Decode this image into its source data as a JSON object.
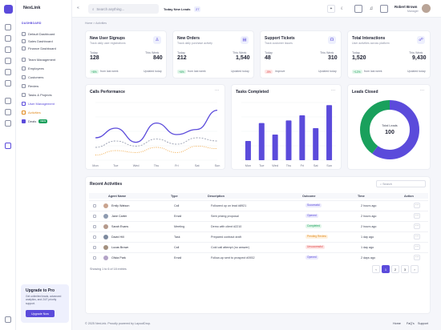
{
  "brand": "NexLink",
  "sidebar": {
    "section": "DASHBOARD",
    "items": [
      "Default Dashboard",
      "Sales Dashboard",
      "Finance Dashboard",
      "Team Management",
      "Employees",
      "Customers",
      "Review",
      "Tasks & Projects",
      "User Management",
      "Activities",
      "Deals"
    ],
    "new_badge": "NEW",
    "promo_title": "Upgrade to Pro",
    "promo_desc": "Get unlimited leads, advanced analytics, and 24/7 priority support.",
    "promo_button": "Upgrade Now"
  },
  "topbar": {
    "search_placeholder": "Search anything...",
    "today_label": "Today New Leads",
    "today_value": "27",
    "user_name": "Robert Brown",
    "user_role": "Manager"
  },
  "breadcrumb": "Home  >  Activities",
  "stats": [
    {
      "title": "New User Signups",
      "sub": "Track daily user registrations",
      "today_label": "Today",
      "today": "128",
      "week_label": "This Week",
      "week": "840",
      "change": "+8%",
      "change_text": "from last week",
      "updated": "Updated today"
    },
    {
      "title": "New Orders",
      "sub": "Track daily purchase activity",
      "today_label": "Today",
      "today": "212",
      "week_label": "This Week",
      "week": "1,540",
      "change": "+6%",
      "change_text": "from last week",
      "updated": "Updated today"
    },
    {
      "title": "Support Tickets",
      "sub": "Track customer issues",
      "today_label": "Today",
      "today": "48",
      "week_label": "This Week",
      "week": "310",
      "change": "-5%",
      "change_text": "improve",
      "updated": "Updated today"
    },
    {
      "title": "Total Interactions",
      "sub": "User activities across platform",
      "today_label": "Today",
      "today": "1,520",
      "week_label": "This Week",
      "week": "9,430",
      "change": "+12%",
      "change_text": "from last week",
      "updated": "Updated today"
    }
  ],
  "calls": {
    "title": "Calls Performance",
    "days": [
      "Mon",
      "Tue",
      "Wed",
      "Thu",
      "Fri",
      "Sat",
      "Sun"
    ]
  },
  "tasks": {
    "title": "Tasks Completed",
    "days": [
      "Mon",
      "Tue",
      "Wed",
      "Thu",
      "Fri",
      "Sat",
      "Sun"
    ]
  },
  "leads": {
    "title": "Leads Closed",
    "center_label": "Total Leads",
    "center_value": "100"
  },
  "chart_data": [
    {
      "type": "line",
      "title": "Calls Performance",
      "categories": [
        "Mon",
        "Tue",
        "Wed",
        "Thu",
        "Fri",
        "Sat",
        "Sun"
      ],
      "series": [
        {
          "values": [
            35,
            50,
            28,
            58,
            40,
            48,
            78
          ]
        },
        {
          "values": [
            20,
            30,
            22,
            33,
            25,
            35,
            30
          ]
        },
        {
          "values": [
            8,
            15,
            12,
            20,
            12,
            22,
            18
          ]
        }
      ]
    },
    {
      "type": "bar",
      "title": "Tasks Completed",
      "categories": [
        "Mon",
        "Tue",
        "Wed",
        "Thu",
        "Fri",
        "Sat",
        "Sun"
      ],
      "values": [
        30,
        58,
        40,
        62,
        70,
        50,
        86
      ]
    },
    {
      "type": "pie",
      "title": "Leads Closed",
      "values": [
        60,
        40
      ],
      "colors": [
        "#5b4bdb",
        "#19a05c"
      ]
    }
  ],
  "activities": {
    "title": "Recent Activities",
    "search_placeholder": "Search",
    "columns": [
      "Agent Name",
      "Type",
      "Description",
      "Outcome",
      "Time",
      "Action"
    ],
    "rows": [
      {
        "name": "Emily Watson",
        "type": "Call",
        "desc": "Followed up on lead #8921",
        "outcome": "Successful",
        "time": "2 hours ago"
      },
      {
        "name": "Jane Carter",
        "type": "Email",
        "desc": "Sent pricing proposal",
        "outcome": "Opened",
        "time": "2 hours ago"
      },
      {
        "name": "Sarah Evans",
        "type": "Meeting",
        "desc": "Demo with client #2210",
        "outcome": "Completed",
        "time": "2 hours ago"
      },
      {
        "name": "David Hill",
        "type": "Task",
        "desc": "Prepared contract draft",
        "outcome": "Pending Review",
        "time": "1 day ago"
      },
      {
        "name": "Lucas Brown",
        "type": "Call",
        "desc": "Cold call attempt (no answer)",
        "outcome": "Unsuccessful",
        "time": "1 day ago"
      },
      {
        "name": "Olivia Park",
        "type": "Email",
        "desc": "Follow-up sent to prospect #0932",
        "outcome": "Opened",
        "time": "2 days ago"
      }
    ],
    "pagination_text": "Showing 1 to 6 of 18 entries",
    "pages": [
      "1",
      "2",
      "3"
    ]
  },
  "footer": {
    "copyright": "© 2025 NexLink. Proudly powered by LayoutDrop.",
    "links": [
      "Home",
      "FaQ's",
      "Support"
    ]
  }
}
